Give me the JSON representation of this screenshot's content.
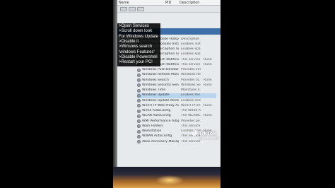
{
  "columns": {
    "name": "Name",
    "pid": "PID",
    "description": "Description"
  },
  "overlay": {
    "lines": [
      ">Open Services",
      ">Scroll down look",
      "For Windows Update",
      ">Disable it",
      ">Winsows search",
      "'windows Features'",
      ">Disable Powershell",
      ">Restart your PC!"
    ]
  },
  "services": [
    {
      "name": "Windows Mobile Hotspot S...",
      "desc": "Description",
      "status": ""
    },
    {
      "name": "Windows Modules Installe...",
      "desc": "Enables inst...",
      "status": ""
    },
    {
      "name": "Windows Perception Servi...",
      "desc": "Enables spat...",
      "status": ""
    },
    {
      "name": "Windows Perception Simul...",
      "desc": "Enables spat...",
      "status": ""
    },
    {
      "name": "Windows Push Notification...",
      "desc": "This service ...",
      "status": "Runn"
    },
    {
      "name": "Windows Push Notification...",
      "desc": "This service ...",
      "status": "Runn"
    },
    {
      "name": "Windows PushToInstall Serv...",
      "desc": "Provides infr...",
      "status": ""
    },
    {
      "name": "Windows Remote Manage...",
      "desc": "Windows Re...",
      "status": ""
    },
    {
      "name": "Windows Search",
      "desc": "Provides co...",
      "status": "Runn"
    },
    {
      "name": "Windows Security Service",
      "desc": "Windows Se...",
      "status": "Runn"
    },
    {
      "name": "Windows Time",
      "desc": "Maintains d...",
      "status": ""
    },
    {
      "name": "Windows Update",
      "desc": "Enables the ...",
      "status": ""
    },
    {
      "name": "Windows Update Medic Se...",
      "desc": "Enables rem...",
      "status": ""
    },
    {
      "name": "WinHTTP Web Proxy Auto...",
      "desc": "WinHTTP im...",
      "status": "Runn"
    },
    {
      "name": "Wired AutoConfig",
      "desc": "The Wired A...",
      "status": ""
    },
    {
      "name": "WLAN AutoConfig",
      "desc": "The WLANS...",
      "status": "Runn"
    },
    {
      "name": "WMI Performance Adapter",
      "desc": "Provides pe...",
      "status": ""
    },
    {
      "name": "Work Folders",
      "desc": "This service ...",
      "status": ""
    },
    {
      "name": "Workstation",
      "desc": "Creates and...",
      "status": "Runn"
    },
    {
      "name": "WWAN AutoConfig",
      "desc": "This service ...",
      "status": ""
    },
    {
      "name": "Xbox Accessory Manage...",
      "desc": "This service ...",
      "status": ""
    }
  ],
  "watermark": {
    "brand": "TikTok",
    "handle": "@erdyco53"
  },
  "colors": {
    "overlay_bg": "#000000",
    "selection": "#b9d4ee",
    "header_band": "#3d6fa8"
  }
}
